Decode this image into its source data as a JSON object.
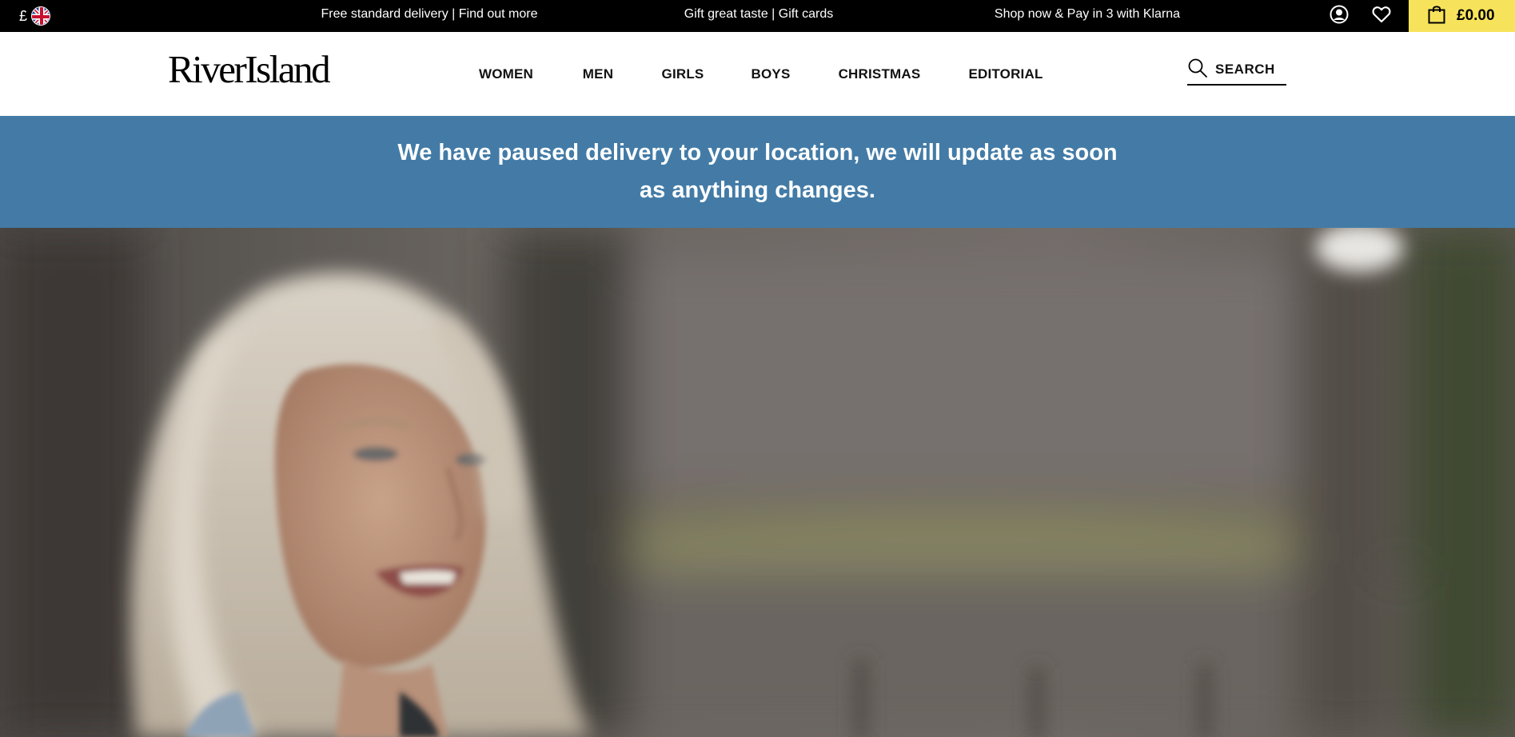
{
  "topbar": {
    "currency_symbol": "£",
    "flag_icon": "uk-flag-icon",
    "promos": [
      "Free standard delivery | Find out more",
      "Gift great taste | Gift cards",
      "Shop now & Pay in 3 with Klarna"
    ],
    "account_icon": "account-icon",
    "wishlist_icon": "heart-icon",
    "basket_icon": "shopping-bag-icon",
    "basket_total": "£0.00"
  },
  "header": {
    "logo": "RiverIsland",
    "nav": [
      "WOMEN",
      "MEN",
      "GIRLS",
      "BOYS",
      "CHRISTMAS",
      "EDITORIAL"
    ],
    "search_label": "SEARCH",
    "search_icon": "search-icon"
  },
  "notice": {
    "message": "We have paused delivery to your location, we will update as soon as anything changes."
  },
  "colors": {
    "topbar_bg": "#000000",
    "basket_bg": "#f7e35b",
    "notice_bg": "#437ba6"
  }
}
